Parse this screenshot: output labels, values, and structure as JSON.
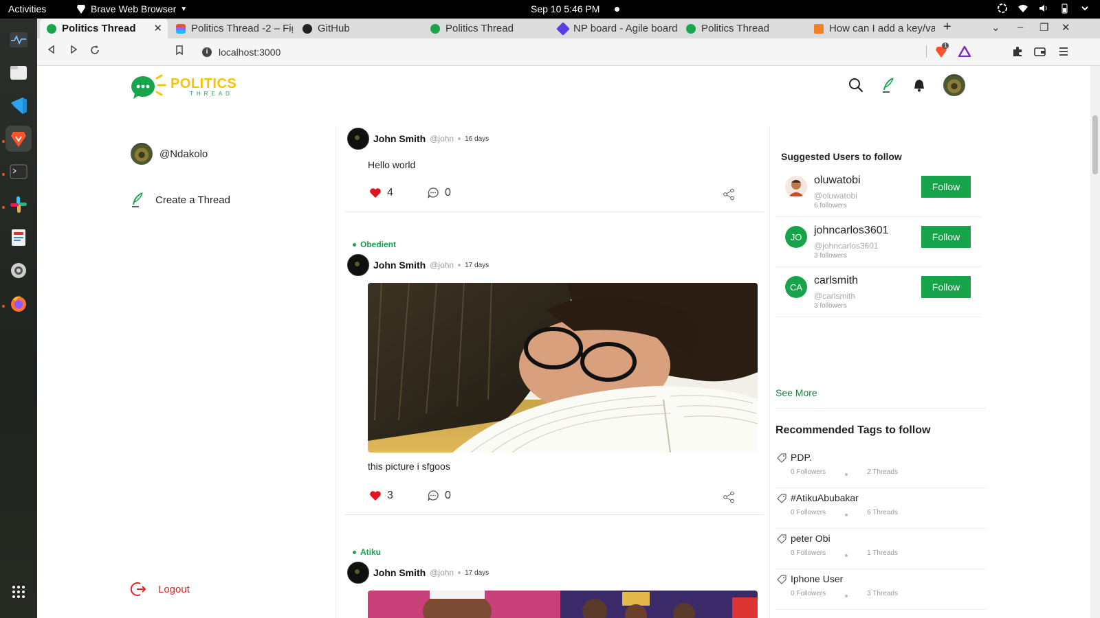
{
  "system": {
    "activities": "Activities",
    "app_name": "Brave Web Browser",
    "clock": "Sep 10  5:46 PM"
  },
  "tabs": [
    {
      "label": "Politics Thread",
      "active": true
    },
    {
      "label": "Politics Thread -2 – Fig",
      "active": false
    },
    {
      "label": "GitHub",
      "active": false
    },
    {
      "label": "Politics Thread",
      "active": false
    },
    {
      "label": "NP board - Agile board",
      "active": false
    },
    {
      "label": "Politics Thread",
      "active": false
    },
    {
      "label": "How can I add a key/va",
      "active": false
    }
  ],
  "address": {
    "url": "localhost:3000",
    "shield_count": "1"
  },
  "header": {
    "logo_text": "POLITICS",
    "logo_sub": "THREAD"
  },
  "sidebar": {
    "username": "@Ndakolo",
    "create_label": "Create a Thread",
    "logout_label": "Logout"
  },
  "posts": [
    {
      "tag": "",
      "author": "John Smith",
      "handle": "@john",
      "age": "16 days",
      "text": "Hello world",
      "likes": "4",
      "comments": "0",
      "has_image": false
    },
    {
      "tag": "Obedient",
      "author": "John Smith",
      "handle": "@john",
      "age": "17 days",
      "text": "this picture i sfgoos",
      "likes": "3",
      "comments": "0",
      "has_image": true
    },
    {
      "tag": "Atiku",
      "author": "John Smith",
      "handle": "@john",
      "age": "17 days",
      "text": "",
      "has_image": true
    }
  ],
  "suggested": {
    "title": "Suggested Users to follow",
    "users": [
      {
        "name": "oluwatobi",
        "handle": "@oluwatobi",
        "followers": "6 followers",
        "initials": "",
        "follow_label": "Follow"
      },
      {
        "name": "johncarlos3601",
        "handle": "@johncarlos3601",
        "followers": "3 followers",
        "initials": "JO",
        "follow_label": "Follow"
      },
      {
        "name": "carlsmith",
        "handle": "@carlsmith",
        "followers": "3 followers",
        "initials": "CA",
        "follow_label": "Follow"
      }
    ],
    "see_more": "See More"
  },
  "tags_section": {
    "title": "Recommended Tags to follow",
    "tags": [
      {
        "name": "PDP.",
        "followers": "0 Followers",
        "threads": "2 Threads"
      },
      {
        "name": "#AtikuAbubakar",
        "followers": "0 Followers",
        "threads": "6 Threads"
      },
      {
        "name": "peter Obi",
        "followers": "0 Followers",
        "threads": "1 Threads"
      },
      {
        "name": "Iphone User",
        "followers": "0 Followers",
        "threads": "3 Threads"
      }
    ]
  },
  "colors": {
    "brand_green": "#17a34a",
    "brand_yellow": "#f5c400",
    "like_red": "#e0161f",
    "logout_red": "#e02424"
  }
}
